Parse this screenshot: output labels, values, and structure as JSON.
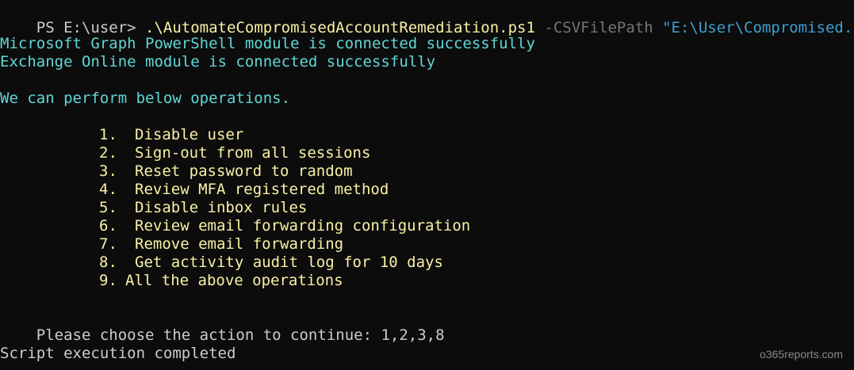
{
  "command_line": {
    "prompt": "PS E:\\user> ",
    "script": ".\\AutomateCompromisedAccountRemediation.ps1",
    "param": " -CSVFilePath ",
    "value": "\"E:\\User\\Compromised.csv\""
  },
  "status": [
    "Microsoft Graph PowerShell module is connected successfully",
    "Exchange Online module is connected successfully"
  ],
  "intro": "We can perform below operations.",
  "menu": [
    {
      "num": "1.",
      "label": "Disable user"
    },
    {
      "num": "2.",
      "label": "Sign-out from all sessions"
    },
    {
      "num": "3.",
      "label": "Reset password to random"
    },
    {
      "num": "4.",
      "label": "Review MFA registered method"
    },
    {
      "num": "5.",
      "label": "Disable inbox rules"
    },
    {
      "num": "6.",
      "label": "Review email forwarding configuration"
    },
    {
      "num": "7.",
      "label": "Remove email forwarding"
    },
    {
      "num": "8.",
      "label": "Get activity audit log for 10 days"
    },
    {
      "num": "9.",
      "label": "All the above operations"
    }
  ],
  "choice_prompt": "Please choose the action to continue: ",
  "choice_value": "1,2,3,8",
  "completion": "Script execution completed",
  "watermark": "o365reports.com",
  "colors": {
    "background": "#0c0c0c",
    "default_text": "#cccccc",
    "cyan": "#61d6d6",
    "yellow": "#f9f1a5",
    "param_gray": "#767676",
    "string_blue": "#3b9fd4"
  }
}
